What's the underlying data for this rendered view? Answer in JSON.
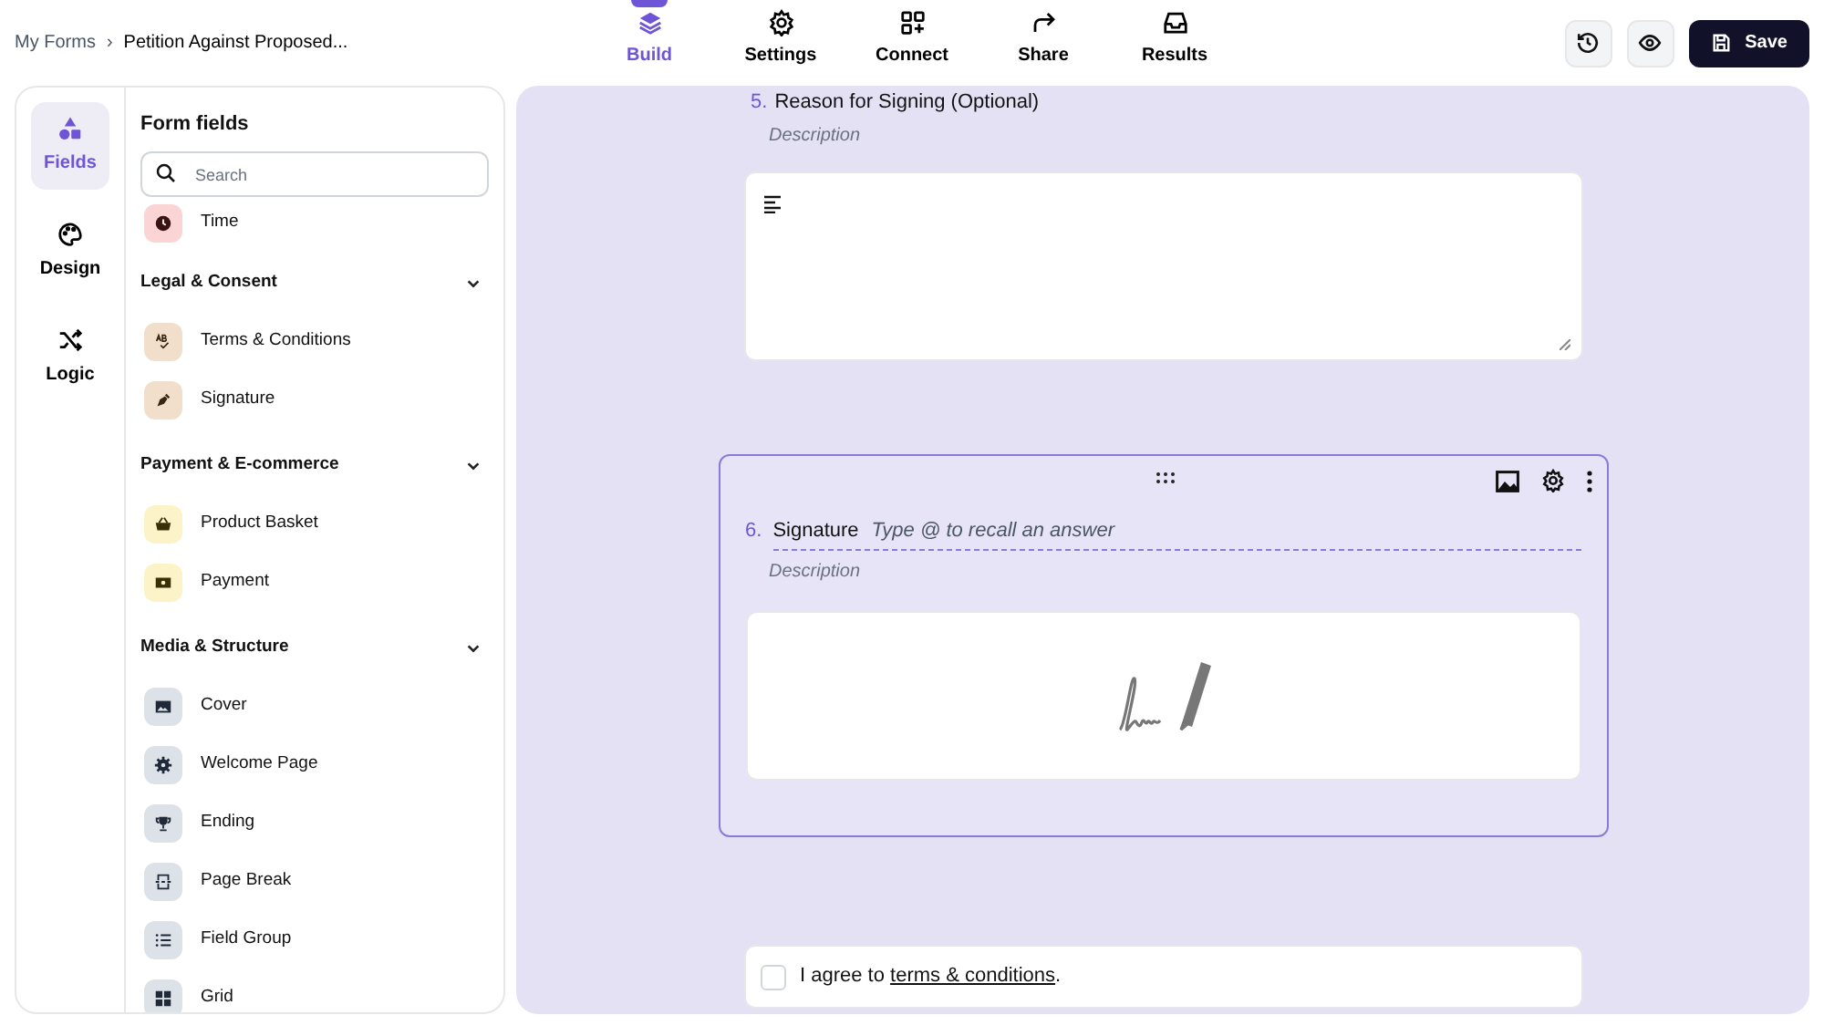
{
  "breadcrumb": {
    "parent": "My Forms",
    "separator": "›",
    "current": "Petition Against Proposed..."
  },
  "nav_tabs": [
    {
      "label": "Build",
      "selected": true
    },
    {
      "label": "Settings",
      "selected": false
    },
    {
      "label": "Connect",
      "selected": false
    },
    {
      "label": "Share",
      "selected": false
    },
    {
      "label": "Results",
      "selected": false
    }
  ],
  "save_button": "Save",
  "rail": [
    {
      "label": "Fields",
      "selected": true
    },
    {
      "label": "Design",
      "selected": false
    },
    {
      "label": "Logic",
      "selected": false
    }
  ],
  "fields_panel": {
    "title": "Form fields",
    "search_placeholder": "Search",
    "loose_items": [
      {
        "label": "Time",
        "color": "#fbd5d5"
      }
    ],
    "groups": [
      {
        "title": "Legal & Consent",
        "expanded": true,
        "color": "#f1dfcc",
        "items": [
          "Terms & Conditions",
          "Signature"
        ]
      },
      {
        "title": "Payment & E-commerce",
        "expanded": true,
        "color": "#fdf3c8",
        "items": [
          "Product Basket",
          "Payment"
        ]
      },
      {
        "title": "Media & Structure",
        "expanded": true,
        "color": "#dde1e8",
        "items": [
          "Cover",
          "Welcome Page",
          "Ending",
          "Page Break",
          "Field Group",
          "Grid"
        ]
      }
    ]
  },
  "canvas": {
    "prev_question": {
      "number": "5.",
      "title": "Reason for Signing (Optional)",
      "description": "Description"
    },
    "active_question": {
      "number": "6.",
      "title": "Signature",
      "placeholder": "Type @ to recall an answer",
      "description": "Description"
    },
    "consent": {
      "checked": false,
      "text_before": "I agree to ",
      "link": "terms & conditions",
      "text_after": "."
    }
  }
}
